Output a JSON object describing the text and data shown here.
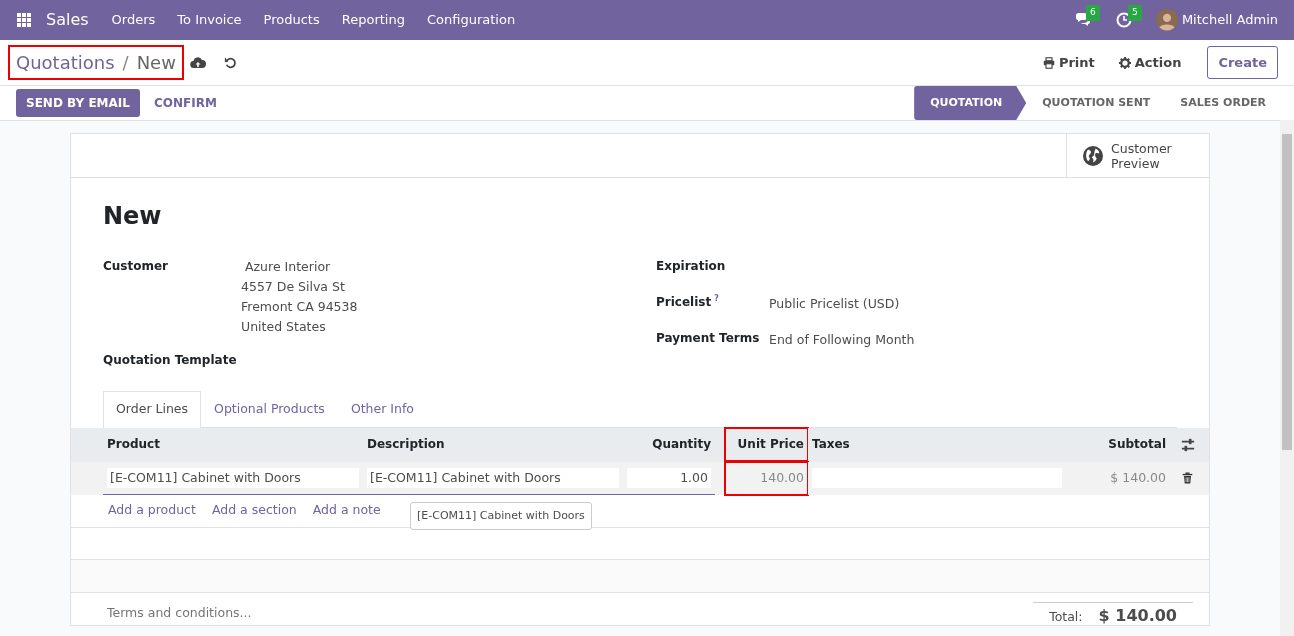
{
  "navbar": {
    "app": "Sales",
    "menu": [
      "Orders",
      "To Invoice",
      "Products",
      "Reporting",
      "Configuration"
    ],
    "messages_count": "6",
    "activities_count": "5",
    "user": "Mitchell Admin"
  },
  "control_panel": {
    "breadcrumb": [
      {
        "label": "Quotations",
        "current": false
      },
      {
        "label": "New",
        "current": true
      }
    ],
    "breadcrumb_highlighted": true,
    "separator": "/",
    "print": "Print",
    "action": "Action",
    "create": "Create"
  },
  "status_bar": {
    "buttons": [
      {
        "label": "SEND BY EMAIL",
        "primary": true
      },
      {
        "label": "CONFIRM",
        "primary": false
      }
    ],
    "stages": [
      {
        "label": "QUOTATION",
        "selected": true
      },
      {
        "label": "QUOTATION SENT",
        "selected": false
      },
      {
        "label": "SALES ORDER",
        "selected": false
      }
    ]
  },
  "smart_button": {
    "label": "Customer Preview"
  },
  "title": "New",
  "left_fields": [
    {
      "label": "Customer",
      "lines": [
        "Azure Interior",
        "4557 De Silva St",
        "Fremont CA 94538",
        "United States"
      ]
    },
    {
      "label": "Quotation Template"
    }
  ],
  "right_fields": [
    {
      "label": "Expiration"
    },
    {
      "label": "Pricelist",
      "help": "?",
      "value": "Public Pricelist (USD)"
    },
    {
      "label": "Payment Terms",
      "value": "End of Following Month"
    }
  ],
  "tabs": [
    {
      "label": "Order Lines",
      "selected": true
    },
    {
      "label": "Optional Products",
      "selected": false
    },
    {
      "label": "Other Info",
      "selected": false
    }
  ],
  "table": {
    "columns": [
      {
        "label": "Product",
        "highlighted": false
      },
      {
        "label": "Description",
        "highlighted": false
      },
      {
        "label": "Quantity",
        "highlighted": false
      },
      {
        "label": "Unit Price",
        "highlighted": true
      },
      {
        "label": "Taxes",
        "highlighted": false
      },
      {
        "label": "Subtotal",
        "highlighted": false
      }
    ],
    "rows": [
      {
        "cells": [
          "[E-COM11] Cabinet with Doors",
          "[E-COM11] Cabinet with Doors",
          "1.00",
          "140.00",
          "",
          "$ 140.00"
        ]
      }
    ],
    "add_links": [
      "Add a product",
      "Add a section",
      "Add a note"
    ],
    "tooltip": "[E-COM11] Cabinet with Doors"
  },
  "terms_placeholder": "Terms and conditions...",
  "total": {
    "label": "Total:",
    "value": "$ 140.00"
  }
}
